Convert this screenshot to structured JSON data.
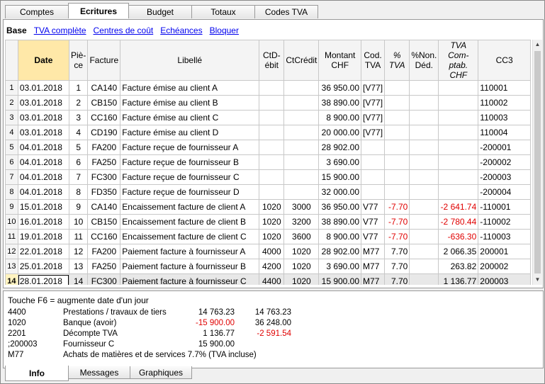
{
  "top_tabs": [
    "Comptes",
    "Ecritures",
    "Budget",
    "Totaux",
    "Codes TVA"
  ],
  "active_tab": "Ecritures",
  "views": {
    "base": "Base",
    "links": [
      "TVA complète",
      "Centres de coût",
      "Echéances",
      "Bloquer"
    ]
  },
  "columns": [
    "",
    "Date",
    "Pièce",
    "Facture",
    "Libellé",
    "CtDébit",
    "CtCrédit",
    "Montant CHF",
    "Cod. TVA",
    "% TVA",
    "%Non. Déd.",
    "TVA Comptab. CHF",
    "CC3"
  ],
  "columns_display": [
    "",
    "Date",
    "Piè-ce",
    "Facture",
    "Libellé",
    "CtD-ébit",
    "CtCrédit",
    "Montant CHF",
    "Cod. TVA",
    "% TVA",
    "%Non. Déd.",
    "TVA Com-ptab. CHF",
    "CC3"
  ],
  "rows": [
    {
      "n": "1",
      "date": "03.01.2018",
      "piece": "1",
      "facture": "CA140",
      "libelle": "Facture émise au client A",
      "debit": "",
      "credit": "",
      "montant": "36 950.00",
      "cod": "[V77]",
      "pct": "",
      "nd": "",
      "tva": "",
      "cc3": "110001"
    },
    {
      "n": "2",
      "date": "03.01.2018",
      "piece": "2",
      "facture": "CB150",
      "libelle": "Facture émise au client B",
      "debit": "",
      "credit": "",
      "montant": "38 890.00",
      "cod": "[V77]",
      "pct": "",
      "nd": "",
      "tva": "",
      "cc3": "110002"
    },
    {
      "n": "3",
      "date": "03.01.2018",
      "piece": "3",
      "facture": "CC160",
      "libelle": "Facture émise au client C",
      "debit": "",
      "credit": "",
      "montant": "8 900.00",
      "cod": "[V77]",
      "pct": "",
      "nd": "",
      "tva": "",
      "cc3": "110003"
    },
    {
      "n": "4",
      "date": "03.01.2018",
      "piece": "4",
      "facture": "CD190",
      "libelle": "Facture émise au client D",
      "debit": "",
      "credit": "",
      "montant": "20 000.00",
      "cod": "[V77]",
      "pct": "",
      "nd": "",
      "tva": "",
      "cc3": "110004"
    },
    {
      "n": "5",
      "date": "04.01.2018",
      "piece": "5",
      "facture": "FA200",
      "libelle": "Facture reçue de fournisseur A",
      "debit": "",
      "credit": "",
      "montant": "28 902.00",
      "cod": "",
      "pct": "",
      "nd": "",
      "tva": "",
      "cc3": "-200001"
    },
    {
      "n": "6",
      "date": "04.01.2018",
      "piece": "6",
      "facture": "FA250",
      "libelle": "Facture reçue de fournisseur B",
      "debit": "",
      "credit": "",
      "montant": "3 690.00",
      "cod": "",
      "pct": "",
      "nd": "",
      "tva": "",
      "cc3": "-200002"
    },
    {
      "n": "7",
      "date": "04.01.2018",
      "piece": "7",
      "facture": "FC300",
      "libelle": "Facture reçue de fournisseur C",
      "debit": "",
      "credit": "",
      "montant": "15 900.00",
      "cod": "",
      "pct": "",
      "nd": "",
      "tva": "",
      "cc3": "-200003"
    },
    {
      "n": "8",
      "date": "04.01.2018",
      "piece": "8",
      "facture": "FD350",
      "libelle": "Facture reçue de fournisseur D",
      "debit": "",
      "credit": "",
      "montant": "32 000.00",
      "cod": "",
      "pct": "",
      "nd": "",
      "tva": "",
      "cc3": "-200004"
    },
    {
      "n": "9",
      "date": "15.01.2018",
      "piece": "9",
      "facture": "CA140",
      "libelle": "Encaissement facture de client A",
      "debit": "1020",
      "credit": "3000",
      "montant": "36 950.00",
      "cod": "V77",
      "pct": "-7.70",
      "nd": "",
      "tva": "-2 641.74",
      "cc3": "-110001"
    },
    {
      "n": "10",
      "date": "16.01.2018",
      "piece": "10",
      "facture": "CB150",
      "libelle": "Encaissement facture de client B",
      "debit": "1020",
      "credit": "3200",
      "montant": "38 890.00",
      "cod": "V77",
      "pct": "-7.70",
      "nd": "",
      "tva": "-2 780.44",
      "cc3": "-110002"
    },
    {
      "n": "11",
      "date": "19.01.2018",
      "piece": "11",
      "facture": "CC160",
      "libelle": "Encaissement facture de client C",
      "debit": "1020",
      "credit": "3600",
      "montant": "8 900.00",
      "cod": "V77",
      "pct": "-7.70",
      "nd": "",
      "tva": "-636.30",
      "cc3": "-110003"
    },
    {
      "n": "12",
      "date": "22.01.2018",
      "piece": "12",
      "facture": "FA200",
      "libelle": "Paiement facture à fournisseur A",
      "debit": "4000",
      "credit": "1020",
      "montant": "28 902.00",
      "cod": "M77",
      "pct": "7.70",
      "nd": "",
      "tva": "2 066.35",
      "cc3": "200001"
    },
    {
      "n": "13",
      "date": "25.01.2018",
      "piece": "13",
      "facture": "FA250",
      "libelle": "Paiement facture à fournisseur B",
      "debit": "4200",
      "credit": "1020",
      "montant": "3 690.00",
      "cod": "M77",
      "pct": "7.70",
      "nd": "",
      "tva": "263.82",
      "cc3": "200002"
    },
    {
      "n": "14",
      "date": "28.01.2018",
      "piece": "14",
      "facture": "FC300",
      "libelle": "Paiement facture à fournisseur C",
      "debit": "4400",
      "credit": "1020",
      "montant": "15 900.00",
      "cod": "M77",
      "pct": "7.70",
      "nd": "",
      "tva": "1 136.77",
      "cc3": "200003"
    }
  ],
  "new_row_marker": "*",
  "selected_row": "14",
  "info": {
    "title": "Touche F6 = augmente date d'un jour",
    "lines": [
      {
        "code": "4400",
        "desc": "Prestations / travaux de tiers",
        "v1": "14 763.23",
        "v2": "14 763.23"
      },
      {
        "code": "1020",
        "desc": "Banque (avoir)",
        "v1": "-15 900.00",
        "v2": "36 248.00"
      },
      {
        "code": "2201",
        "desc": "Décompte TVA",
        "v1": "1 136.77",
        "v2": "-2 591.54"
      },
      {
        "code": ";200003",
        "desc": "Fournisseur C",
        "v1": "15 900.00",
        "v2": ""
      },
      {
        "code": "M77",
        "desc": "Achats de matières et de services 7.7% (TVA incluse)",
        "v1": "",
        "v2": ""
      }
    ]
  },
  "bottom_tabs": [
    "Info",
    "Messages",
    "Graphiques"
  ],
  "active_bottom_tab": "Info",
  "colors": {
    "negative": "#e00000",
    "date_header": "#ffe8a8",
    "link": "#0000ee"
  }
}
